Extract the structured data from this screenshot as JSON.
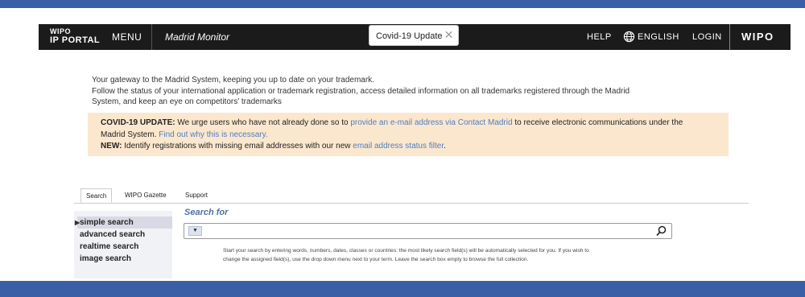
{
  "header": {
    "logo_line1": "WIPO",
    "logo_line2": "IP PORTAL",
    "menu": "MENU",
    "app_title": "Madrid Monitor",
    "covid_button": "Covid-19 Update",
    "help": "HELP",
    "language": "ENGLISH",
    "login": "LOGIN",
    "wipo_logo": "WIPO"
  },
  "intro": {
    "line1": "Your gateway to the Madrid System, keeping you up to date on your trademark.",
    "line2": "Follow the status of your international application or trademark registration, access detailed information on all trademarks registered through the Madrid",
    "line3": "System, and keep an eye on competitors' trademarks"
  },
  "notice": {
    "covid_label": "COVID-19 UPDATE:",
    "covid_text1": " We urge users who have not already done so to ",
    "covid_link1": "provide an e-mail address via Contact Madrid",
    "covid_text2": " to receive electronic communications under the",
    "covid_text3": "Madrid System. ",
    "covid_link2": "Find out why this is necessary.",
    "new_label": "NEW:",
    "new_text": " Identify registrations with missing email addresses with our new ",
    "new_link": "email address status filter",
    "new_end": "."
  },
  "tabs": [
    "Search",
    "WIPO Gazette",
    "Support"
  ],
  "nav": [
    "simple search",
    "advanced search",
    "realtime search",
    "image search"
  ],
  "search": {
    "heading": "Search for",
    "value": "",
    "hint_line1": "Start your search by entering words, numbers, dates, classes or countries: the most likely search field(s) will be automatically selected for you. If you wish to",
    "hint_line2": "change the assigned field(s), use the drop down menu next to your term. Leave the search box empty to browse the full collection."
  },
  "icons": {
    "globe": "globe-icon",
    "search": "search-icon",
    "close": "close-icon",
    "dropdown": "triangle-down-icon"
  },
  "colors": {
    "header_bg": "#1b1b1b",
    "frame_blue": "#3a5fa6",
    "notice_bg": "#fbe7cd",
    "link": "#4f7fbf"
  }
}
